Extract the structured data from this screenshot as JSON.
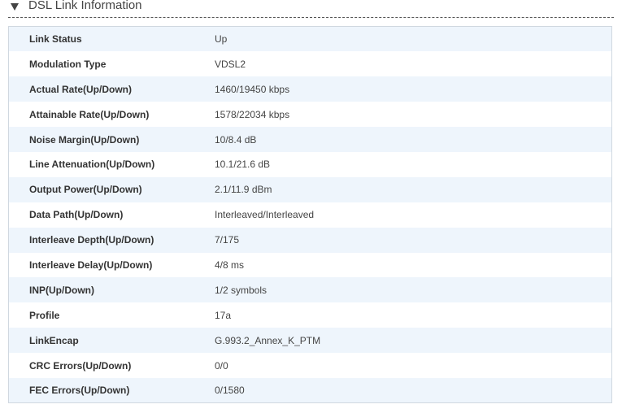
{
  "section": {
    "title": "DSL Link Information",
    "icon": "triangle-down-icon"
  },
  "rows": [
    {
      "label": "Link Status",
      "value": "Up"
    },
    {
      "label": "Modulation Type",
      "value": "VDSL2"
    },
    {
      "label": "Actual Rate(Up/Down)",
      "value": "1460/19450 kbps"
    },
    {
      "label": "Attainable Rate(Up/Down)",
      "value": "1578/22034 kbps"
    },
    {
      "label": "Noise Margin(Up/Down)",
      "value": "10/8.4 dB"
    },
    {
      "label": "Line Attenuation(Up/Down)",
      "value": "10.1/21.6 dB"
    },
    {
      "label": "Output Power(Up/Down)",
      "value": "2.1/11.9 dBm"
    },
    {
      "label": "Data Path(Up/Down)",
      "value": "Interleaved/Interleaved"
    },
    {
      "label": "Interleave Depth(Up/Down)",
      "value": "7/175"
    },
    {
      "label": "Interleave Delay(Up/Down)",
      "value": "4/8 ms"
    },
    {
      "label": "INP(Up/Down)",
      "value": "1/2 symbols"
    },
    {
      "label": "Profile",
      "value": "17a"
    },
    {
      "label": "LinkEncap",
      "value": "G.993.2_Annex_K_PTM"
    },
    {
      "label": "CRC Errors(Up/Down)",
      "value": "0/0"
    },
    {
      "label": "FEC Errors(Up/Down)",
      "value": "0/1580"
    }
  ]
}
